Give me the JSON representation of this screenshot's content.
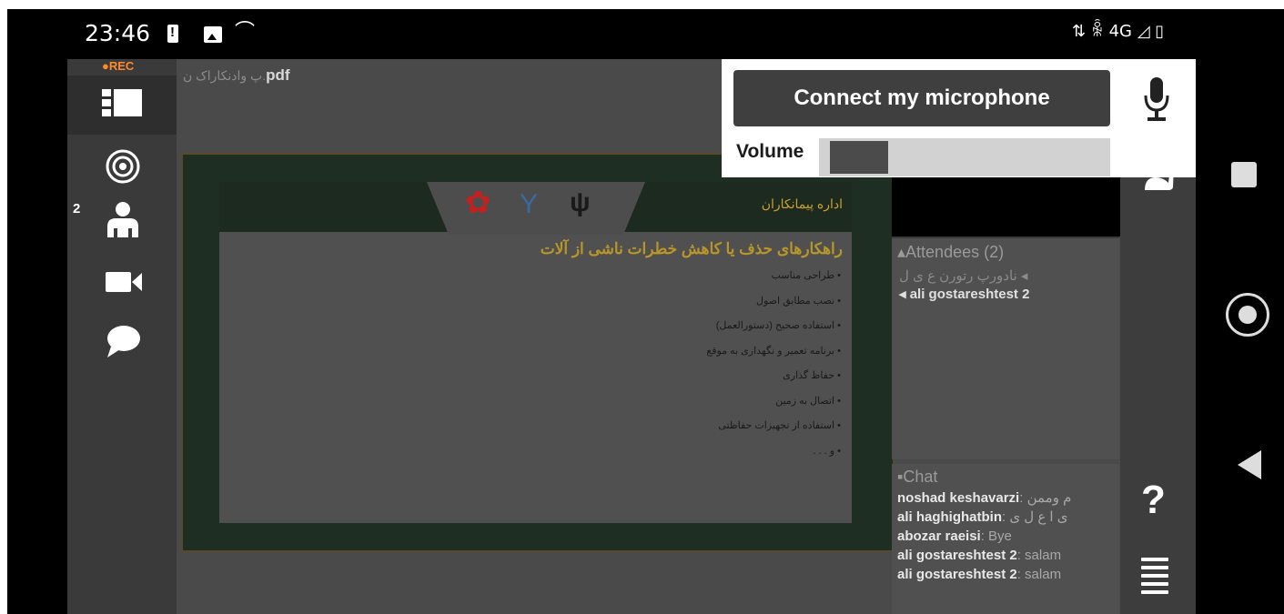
{
  "status_bar": {
    "time": "23:46",
    "right_icons": "⇅ ꆛ 4G ◿ ▯",
    "icons": [
      "battery-alert-icon",
      "image-icon",
      "missed-call-icon",
      "data-arrows-icon",
      "vpn-icon",
      "network-4g-icon",
      "signal-icon",
      "battery-icon"
    ]
  },
  "left_bar": {
    "rec_label": "●REC",
    "user_count": "2",
    "icons": [
      "layout-icon",
      "audio-broadcast-icon",
      "users-icon",
      "video-camera-icon",
      "chat-bubble-icon"
    ]
  },
  "document": {
    "title_fa": "پ وادنکاراک ن.",
    "title_ext": "pdf"
  },
  "slide": {
    "header_text": "اداره پیمانکاران",
    "title": "راهکارهای حذف یا کاهش خطرات ناشی از آلات",
    "bullets": [
      "طراحی مناسب",
      "نصب مطابق اصول",
      "استفاده صحیح (دستورالعمل)",
      "برنامه تعمیر و نگهداری به موقع",
      "حفاظ گذاری",
      "اتصال به زمین",
      "استفاده از تجهیزات حفاظتی",
      "و . . ."
    ],
    "logos": [
      "ministry-seal-icon",
      "organization-logo-icon",
      "iran-emblem-icon"
    ]
  },
  "microphone_panel": {
    "connect_label": "Connect my microphone",
    "volume_label": "Volume",
    "volume_level": 0.2
  },
  "attendees": {
    "title": "▴Attendees (2)",
    "list": [
      {
        "name": "◂ نادورپ رتورن ع ی ل",
        "is_fa": true
      },
      {
        "name": "◂ ali gostareshtest 2",
        "is_fa": false
      }
    ]
  },
  "chat": {
    "title": "▪Chat",
    "messages": [
      {
        "author": "noshad keshavarzi",
        "text": ": م وممن"
      },
      {
        "author": "ali haghighatbin",
        "text": ": ی ا ع ل ی"
      },
      {
        "author": "abozar raeisi",
        "text": ": Bye"
      },
      {
        "author": "ali gostareshtest 2",
        "text": ": salam"
      },
      {
        "author": "ali gostareshtest 2",
        "text": ": salam"
      }
    ]
  },
  "right_bar": {
    "help_label": "?",
    "icons": [
      "microphone-icon",
      "raise-hand-icon",
      "help-icon",
      "menu-icon"
    ]
  },
  "android_nav": {
    "icons": [
      "recents-square-icon",
      "home-circle-icon",
      "back-triangle-icon"
    ]
  },
  "colors": {
    "app_bg": "#4a4a4a",
    "rec": "#ff8a2a",
    "button_dark": "#3f3f3f",
    "slide_title": "#b8962a"
  }
}
